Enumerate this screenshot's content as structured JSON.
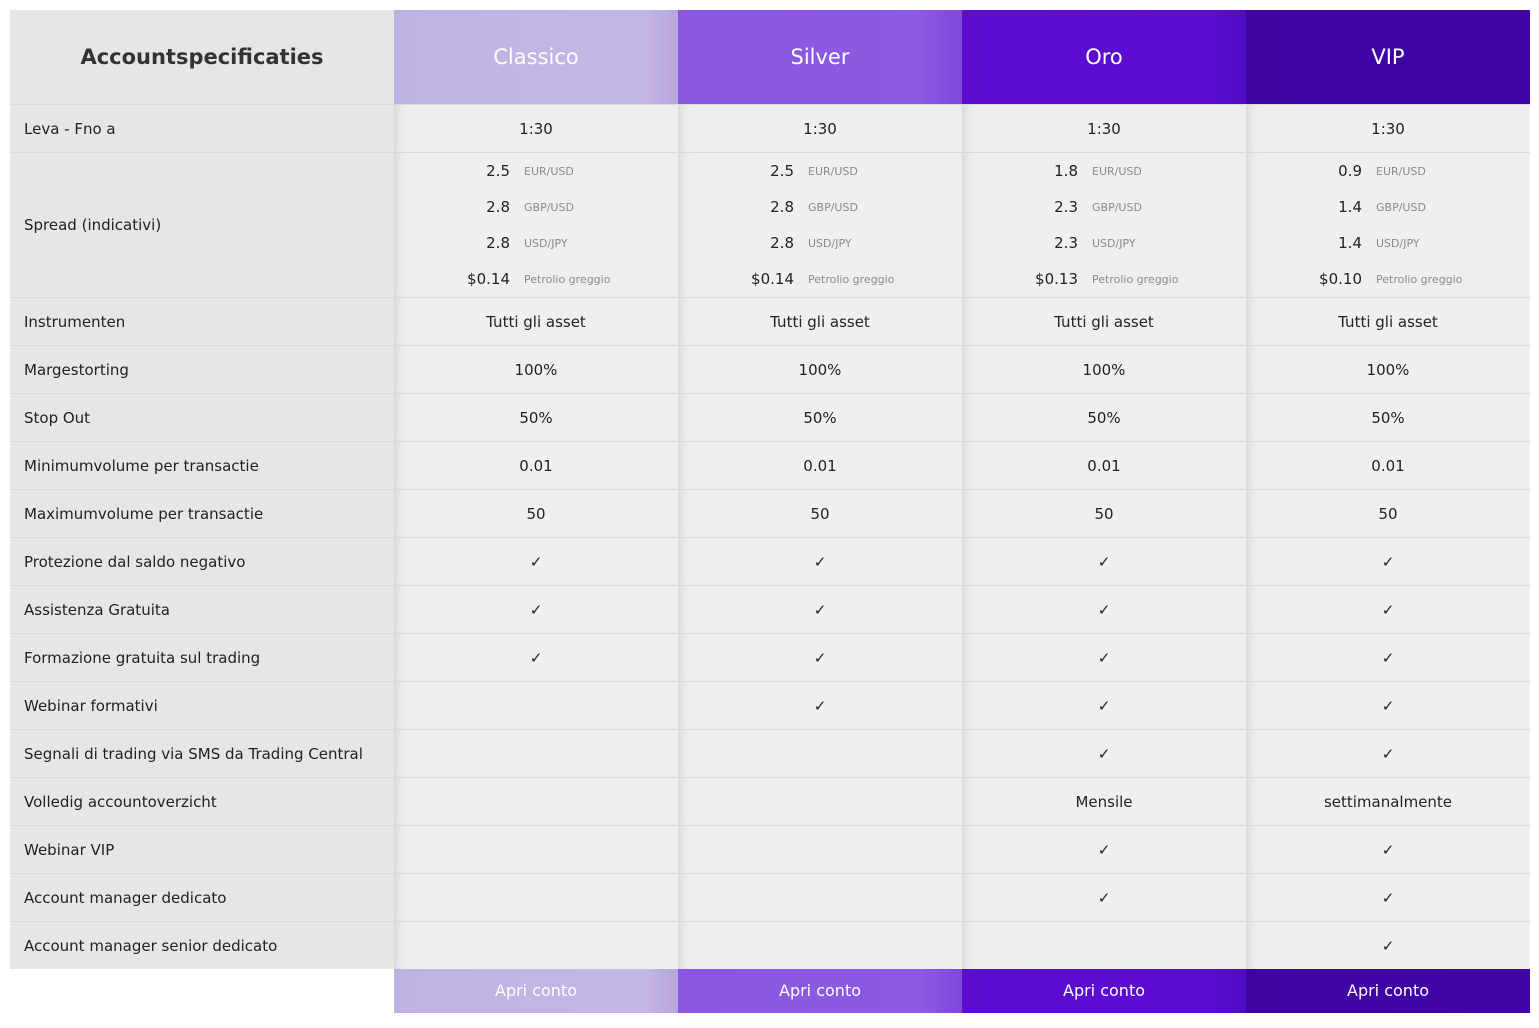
{
  "table": {
    "spec_header": "Accountspecificaties",
    "plans": [
      {
        "name": "Classico",
        "color": "#c0b2e2"
      },
      {
        "name": "Silver",
        "color": "#8a57e0"
      },
      {
        "name": "Oro",
        "color": "#5a0ccf"
      },
      {
        "name": "VIP",
        "color": "#3e05a3"
      }
    ],
    "rows": [
      {
        "label": "Leva - Fno a",
        "values": [
          "1:30",
          "1:30",
          "1:30",
          "1:30"
        ]
      },
      {
        "label": "Spread (indicativi)",
        "spread": [
          [
            {
              "value": "2.5",
              "pair": "EUR/USD"
            },
            {
              "value": "2.8",
              "pair": "GBP/USD"
            },
            {
              "value": "2.8",
              "pair": "USD/JPY"
            },
            {
              "value": "$0.14",
              "pair": "Petrolio greggio"
            }
          ],
          [
            {
              "value": "2.5",
              "pair": "EUR/USD"
            },
            {
              "value": "2.8",
              "pair": "GBP/USD"
            },
            {
              "value": "2.8",
              "pair": "USD/JPY"
            },
            {
              "value": "$0.14",
              "pair": "Petrolio greggio"
            }
          ],
          [
            {
              "value": "1.8",
              "pair": "EUR/USD"
            },
            {
              "value": "2.3",
              "pair": "GBP/USD"
            },
            {
              "value": "2.3",
              "pair": "USD/JPY"
            },
            {
              "value": "$0.13",
              "pair": "Petrolio greggio"
            }
          ],
          [
            {
              "value": "0.9",
              "pair": "EUR/USD"
            },
            {
              "value": "1.4",
              "pair": "GBP/USD"
            },
            {
              "value": "1.4",
              "pair": "USD/JPY"
            },
            {
              "value": "$0.10",
              "pair": "Petrolio greggio"
            }
          ]
        ]
      },
      {
        "label": "Instrumenten",
        "values": [
          "Tutti gli asset",
          "Tutti gli asset",
          "Tutti gli asset",
          "Tutti gli asset"
        ]
      },
      {
        "label": "Margestorting",
        "values": [
          "100%",
          "100%",
          "100%",
          "100%"
        ]
      },
      {
        "label": "Stop Out",
        "values": [
          "50%",
          "50%",
          "50%",
          "50%"
        ]
      },
      {
        "label": "Minimumvolume per transactie",
        "values": [
          "0.01",
          "0.01",
          "0.01",
          "0.01"
        ]
      },
      {
        "label": "Maximumvolume per transactie",
        "values": [
          "50",
          "50",
          "50",
          "50"
        ]
      },
      {
        "label": "Protezione dal saldo negativo",
        "values": [
          "✓",
          "✓",
          "✓",
          "✓"
        ]
      },
      {
        "label": "Assistenza Gratuita",
        "values": [
          "✓",
          "✓",
          "✓",
          "✓"
        ]
      },
      {
        "label": "Formazione gratuita sul trading",
        "values": [
          "✓",
          "✓",
          "✓",
          "✓"
        ]
      },
      {
        "label": "Webinar formativi",
        "values": [
          "",
          "✓",
          "✓",
          "✓"
        ]
      },
      {
        "label": "Segnali di trading via SMS da Trading Central",
        "values": [
          "",
          "",
          "✓",
          "✓"
        ]
      },
      {
        "label": "Volledig accountoverzicht",
        "values": [
          "",
          "",
          "Mensile",
          "settimanalmente"
        ]
      },
      {
        "label": "Webinar VIP",
        "values": [
          "",
          "",
          "✓",
          "✓"
        ]
      },
      {
        "label": "Account manager dedicato",
        "values": [
          "",
          "",
          "✓",
          "✓"
        ]
      },
      {
        "label": "Account manager senior dedicato",
        "values": [
          "",
          "",
          "",
          "✓"
        ]
      }
    ],
    "open_account_label": "Apri conto"
  }
}
